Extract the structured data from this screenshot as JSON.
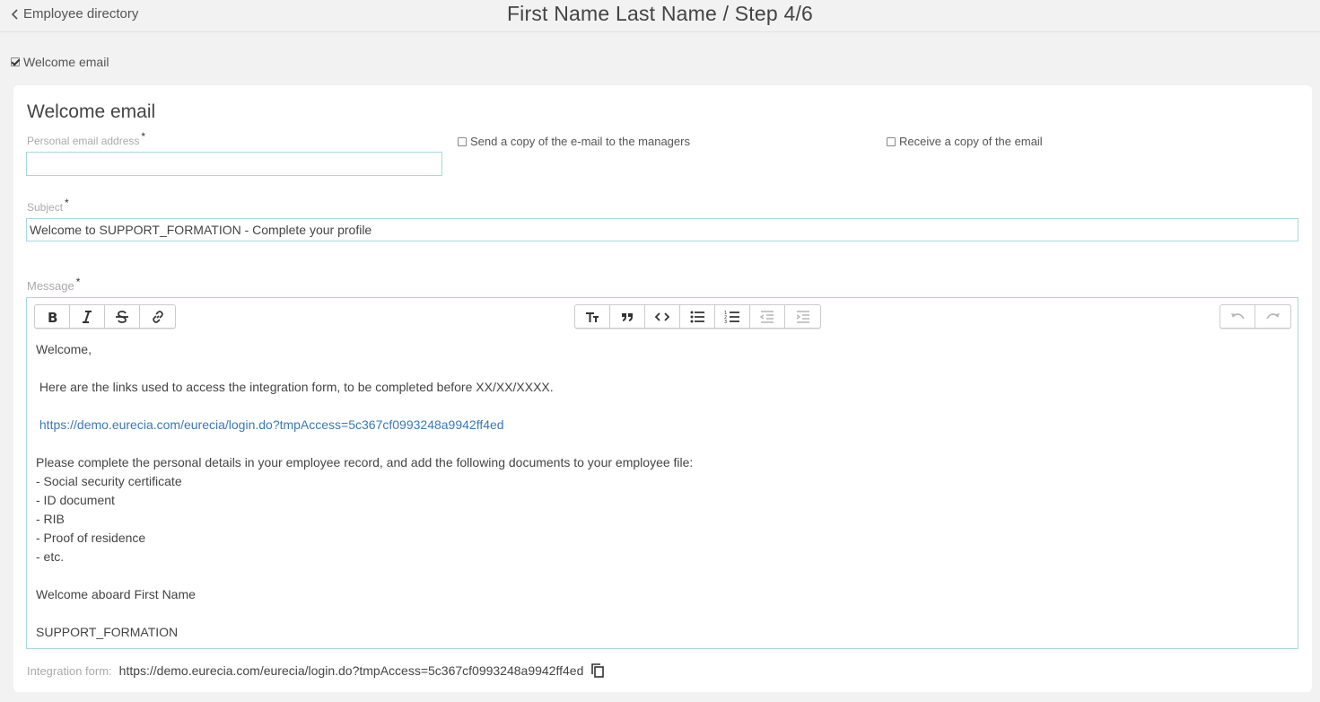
{
  "header": {
    "back_label": "Employee directory",
    "title": "First Name Last Name / Step 4/6"
  },
  "welcome_toggle": {
    "label": "Welcome email",
    "checked": true
  },
  "form": {
    "title": "Welcome email",
    "email_label": "Personal email address",
    "required_mark": "*",
    "email_value": "",
    "send_copy_managers_label": "Send a copy of the e-mail to the managers",
    "send_copy_managers_checked": false,
    "receive_copy_label": "Receive a copy of the email",
    "receive_copy_checked": false,
    "subject_label": "Subject",
    "subject_value": "Welcome to SUPPORT_FORMATION - Complete your profile",
    "message_label": "Message"
  },
  "toolbar": {
    "group1": [
      "bold-icon",
      "italic-icon",
      "strikethrough-icon",
      "link-icon"
    ],
    "group2": [
      "heading-icon",
      "quote-icon",
      "code-icon",
      "bullet-list-icon",
      "numbered-list-icon",
      "outdent-icon",
      "indent-icon"
    ],
    "group3": [
      "undo-icon",
      "redo-icon"
    ]
  },
  "message": {
    "greeting": "Welcome,",
    "intro": " Here are the links used to access the integration form, to be completed before XX/XX/XXXX.",
    "link": " https://demo.eurecia.com/eurecia/login.do?tmpAccess=5c367cf0993248a9942ff4ed",
    "instructions": "Please complete the personal details in your employee record, and add the following documents to your employee file:",
    "docs": [
      "- Social security certificate",
      "- ID document",
      "- RIB",
      "- Proof of residence",
      "- etc."
    ],
    "closing": "Welcome aboard First Name",
    "signature": "SUPPORT_FORMATION"
  },
  "integration": {
    "label": "Integration form:",
    "url": "https://demo.eurecia.com/eurecia/login.do?tmpAccess=5c367cf0993248a9942ff4ed"
  },
  "colors": {
    "link": "#3a79b8",
    "input_border": "#a8d8df",
    "background": "#f2f2f2"
  }
}
